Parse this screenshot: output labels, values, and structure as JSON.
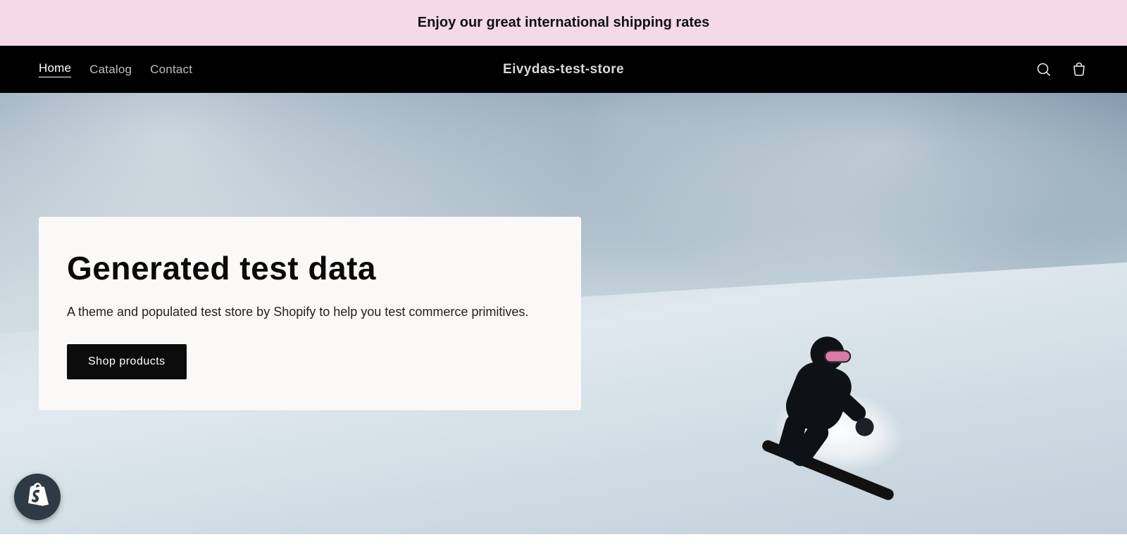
{
  "announcement": {
    "text": "Enjoy our great international shipping rates"
  },
  "header": {
    "nav": [
      {
        "label": "Home",
        "active": true
      },
      {
        "label": "Catalog",
        "active": false
      },
      {
        "label": "Contact",
        "active": false
      }
    ],
    "store_name": "Eivydas-test-store",
    "icons": {
      "search": "search-icon",
      "cart": "cart-icon"
    }
  },
  "hero": {
    "title": "Generated test data",
    "subtitle": "A theme and populated test store by Shopify to help you test commerce primitives.",
    "cta_label": "Shop products",
    "image_description": "Snowboarder in black outfit with pink goggles carving down a snowy slope under a cloudy blue sky"
  },
  "badge": {
    "name": "shopify-badge"
  }
}
